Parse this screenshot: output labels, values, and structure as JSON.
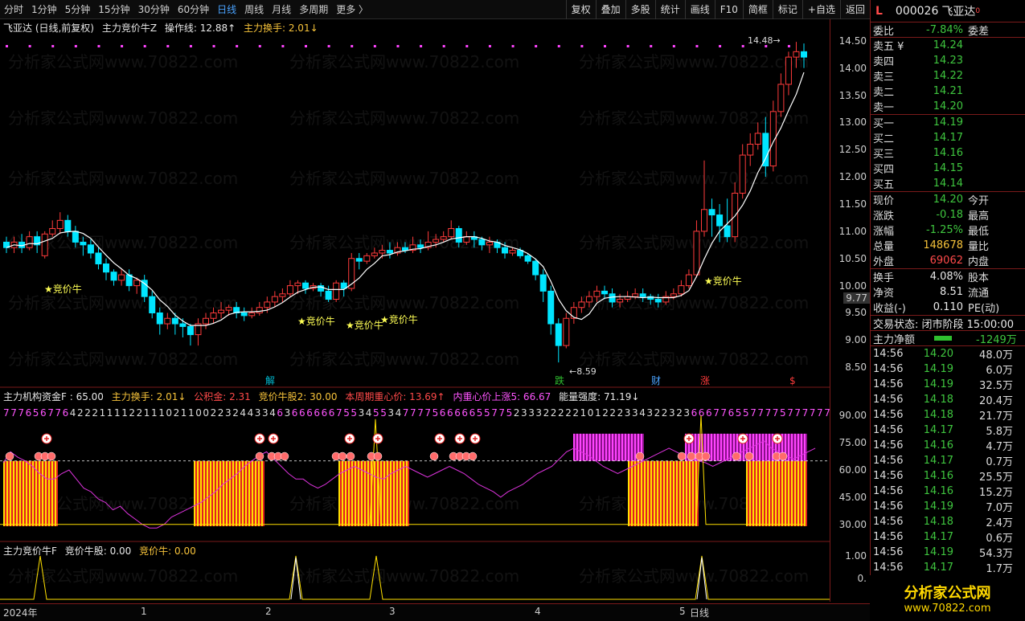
{
  "toolbar": {
    "periods": [
      "分时",
      "1分钟",
      "5分钟",
      "15分钟",
      "30分钟",
      "60分钟",
      "日线",
      "周线",
      "月线",
      "多周期",
      "更多 〉"
    ],
    "active_period": "日线",
    "tools": [
      "复权",
      "叠加",
      "多股",
      "统计",
      "画线",
      "F10",
      "简框",
      "标记",
      "+自选",
      "返回"
    ]
  },
  "main_panel": {
    "title": "飞亚达 (日线,前复权)",
    "indicator": "主力竞价牛Z",
    "op_line": "操作线: 12.88↑",
    "turnover": "主力换手: 2.01↓",
    "yticks": [
      "14.50",
      "14.00",
      "13.50",
      "13.00",
      "12.50",
      "12.00",
      "11.50",
      "11.00",
      "10.50",
      "10.00",
      "9.50",
      "9.00",
      "8.50"
    ],
    "price_marker": "9.77",
    "high_label": "14.48",
    "low_label": "8.59",
    "signal_label": "★竞价牛",
    "event_labels": [
      "解",
      "跌",
      "财",
      "涨",
      "$"
    ]
  },
  "mid_panel": {
    "title": "主力机构资金F : 65.00",
    "turnover": "主力换手: 2.01↓",
    "fund": "公积金: 2.31",
    "bull_stock2": "竞价牛股2: 30.00",
    "week_center": "本周期重心价: 13.69↑",
    "inner_center": "内重心价上涨5: 66.67",
    "energy": "能量强度: 71.19↓",
    "digits": "7776567764222111122111021100223244334636666667553455347777566666557752333222221012223343223236667765577775777777",
    "yticks": [
      "90.00",
      "75.00",
      "60.00",
      "45.00",
      "30.00"
    ]
  },
  "bottom_panel": {
    "title": "主力竞价牛F",
    "bull_stock": "竞价牛股: 0.00",
    "bull": "竞价牛: 0.00",
    "yticks": [
      "1.00",
      "0."
    ]
  },
  "xaxis": {
    "labels": [
      "2024年",
      "1",
      "2",
      "3",
      "4",
      "5"
    ],
    "right_label": "日线"
  },
  "quote": {
    "code": "000026",
    "name": "飞亚达",
    "badge_left": "L",
    "weibi_label": "委比",
    "weibi": "-7.84%",
    "weicha_label": "委差",
    "asks": [
      {
        "label": "卖五 ¥",
        "price": "14.24"
      },
      {
        "label": "卖四",
        "price": "14.23"
      },
      {
        "label": "卖三",
        "price": "14.22"
      },
      {
        "label": "卖二",
        "price": "14.21"
      },
      {
        "label": "卖一",
        "price": "14.20"
      }
    ],
    "bids": [
      {
        "label": "买一",
        "price": "14.19"
      },
      {
        "label": "买二",
        "price": "14.17"
      },
      {
        "label": "买三",
        "price": "14.16"
      },
      {
        "label": "买四",
        "price": "14.15"
      },
      {
        "label": "买五",
        "price": "14.14"
      }
    ],
    "stats": [
      {
        "a": "现价",
        "b": "14.20",
        "bc": "g",
        "c": "今开"
      },
      {
        "a": "涨跌",
        "b": "-0.18",
        "bc": "g",
        "c": "最高"
      },
      {
        "a": "涨幅",
        "b": "-1.25%",
        "bc": "g",
        "c": "最低"
      },
      {
        "a": "总量",
        "b": "148678",
        "bc": "y",
        "c": "量比"
      },
      {
        "a": "外盘",
        "b": "69062",
        "bc": "r",
        "c": "内盘"
      }
    ],
    "stats2": [
      {
        "a": "换手",
        "b": "4.08%",
        "c": "股本"
      },
      {
        "a": "净资",
        "b": "8.51",
        "c": "流通"
      },
      {
        "a": "收益(-)",
        "b": "0.110",
        "c": "PE(动)"
      }
    ],
    "trade_state": "交易状态: 闭市阶段 15:00:00",
    "net_label": "主力净额",
    "net_value": "-1249万",
    "ticks": [
      {
        "t": "14:56",
        "p": "14.20",
        "pc": "g",
        "v": "48.0万",
        "vc": "y"
      },
      {
        "t": "14:56",
        "p": "14.19",
        "pc": "g",
        "v": "6.0万",
        "vc": "y"
      },
      {
        "t": "14:56",
        "p": "14.19",
        "pc": "g",
        "v": "32.5万",
        "vc": "y"
      },
      {
        "t": "14:56",
        "p": "14.18",
        "pc": "g",
        "v": "20.4万",
        "vc": "y"
      },
      {
        "t": "14:56",
        "p": "14.18",
        "pc": "g",
        "v": "21.7万",
        "vc": "y"
      },
      {
        "t": "14:56",
        "p": "14.17",
        "pc": "g",
        "v": "5.8万",
        "vc": "y"
      },
      {
        "t": "14:56",
        "p": "14.16",
        "pc": "g",
        "v": "4.7万",
        "vc": "y"
      },
      {
        "t": "14:56",
        "p": "14.17",
        "pc": "g",
        "v": "0.7万",
        "vc": "y"
      },
      {
        "t": "14:56",
        "p": "14.16",
        "pc": "g",
        "v": "25.5万",
        "vc": "y"
      },
      {
        "t": "14:56",
        "p": "14.16",
        "pc": "g",
        "v": "15.2万",
        "vc": "y"
      },
      {
        "t": "14:56",
        "p": "14.19",
        "pc": "g",
        "v": "7.0万",
        "vc": "y"
      },
      {
        "t": "14:56",
        "p": "14.18",
        "pc": "g",
        "v": "2.4万",
        "vc": "y"
      },
      {
        "t": "14:56",
        "p": "14.17",
        "pc": "g",
        "v": "0.6万",
        "vc": "y"
      },
      {
        "t": "14:56",
        "p": "14.19",
        "pc": "g",
        "v": "54.3万",
        "vc": "y"
      },
      {
        "t": "14:56",
        "p": "14.17",
        "pc": "g",
        "v": "1.7万",
        "vc": "y"
      }
    ]
  },
  "watermark": "分析家公式网www.70822.com",
  "logo": {
    "t1": "分析家公式网",
    "t2": "www.70822.com"
  },
  "chart_data": {
    "type": "candlestick",
    "ylim": [
      8.4,
      14.6
    ],
    "candles": [
      [
        10.8,
        10.7,
        10.9,
        10.6
      ],
      [
        10.7,
        10.8,
        10.9,
        10.6
      ],
      [
        10.8,
        10.7,
        10.95,
        10.6
      ],
      [
        10.7,
        10.9,
        11.0,
        10.65
      ],
      [
        10.9,
        10.75,
        11.0,
        10.6
      ],
      [
        10.55,
        10.95,
        11.0,
        10.5
      ],
      [
        10.95,
        11.05,
        11.2,
        10.9
      ],
      [
        11.05,
        11.2,
        11.35,
        10.95
      ],
      [
        11.2,
        11.0,
        11.3,
        10.9
      ],
      [
        11.0,
        10.8,
        11.1,
        10.7
      ],
      [
        10.8,
        10.75,
        10.9,
        10.55
      ],
      [
        10.75,
        10.6,
        10.85,
        10.5
      ],
      [
        10.6,
        10.4,
        10.7,
        10.3
      ],
      [
        10.4,
        10.25,
        10.5,
        10.1
      ],
      [
        10.25,
        10.1,
        10.3,
        10.0
      ],
      [
        10.1,
        10.2,
        10.3,
        10.0
      ],
      [
        10.2,
        10.0,
        10.3,
        9.9
      ],
      [
        10.0,
        10.1,
        10.15,
        9.85
      ],
      [
        10.1,
        9.8,
        10.2,
        9.7
      ],
      [
        9.8,
        9.5,
        9.9,
        9.4
      ],
      [
        9.5,
        9.3,
        9.6,
        9.1
      ],
      [
        9.3,
        9.4,
        9.5,
        9.2
      ],
      [
        9.4,
        9.3,
        9.5,
        9.1
      ],
      [
        9.3,
        9.25,
        9.4,
        9.05
      ],
      [
        9.25,
        9.1,
        9.3,
        8.9
      ],
      [
        9.1,
        9.3,
        9.4,
        8.9
      ],
      [
        9.3,
        9.4,
        9.5,
        9.2
      ],
      [
        9.4,
        9.5,
        9.6,
        9.3
      ],
      [
        9.5,
        9.55,
        9.7,
        9.4
      ],
      [
        9.55,
        9.6,
        9.65,
        9.45
      ],
      [
        9.6,
        9.5,
        9.7,
        9.4
      ],
      [
        9.5,
        9.45,
        9.6,
        9.35
      ],
      [
        9.45,
        9.5,
        9.6,
        9.4
      ],
      [
        9.5,
        9.6,
        9.7,
        9.45
      ],
      [
        9.6,
        9.7,
        9.8,
        9.5
      ],
      [
        9.7,
        9.8,
        9.9,
        9.6
      ],
      [
        9.8,
        9.85,
        9.95,
        9.7
      ],
      [
        9.85,
        10.0,
        10.1,
        9.8
      ],
      [
        10.0,
        10.05,
        10.1,
        9.85
      ],
      [
        10.05,
        9.95,
        10.1,
        9.85
      ],
      [
        9.95,
        10.0,
        10.05,
        9.9
      ],
      [
        10.0,
        9.9,
        10.05,
        9.8
      ],
      [
        9.9,
        9.75,
        10.0,
        9.7
      ],
      [
        9.75,
        10.05,
        10.1,
        9.7
      ],
      [
        10.05,
        9.95,
        10.1,
        9.8
      ],
      [
        9.95,
        10.5,
        10.6,
        9.9
      ],
      [
        10.5,
        10.45,
        10.6,
        10.3
      ],
      [
        10.45,
        10.55,
        10.6,
        10.4
      ],
      [
        10.55,
        10.6,
        10.7,
        10.5
      ],
      [
        10.6,
        10.65,
        10.75,
        10.5
      ],
      [
        10.65,
        10.6,
        10.8,
        10.5
      ],
      [
        10.6,
        10.7,
        10.8,
        10.55
      ],
      [
        10.7,
        10.65,
        10.8,
        10.6
      ],
      [
        10.65,
        10.75,
        10.9,
        10.6
      ],
      [
        10.75,
        10.7,
        10.85,
        10.6
      ],
      [
        10.7,
        10.8,
        11.0,
        10.65
      ],
      [
        10.8,
        10.85,
        10.95,
        10.7
      ],
      [
        10.85,
        10.9,
        11.0,
        10.8
      ],
      [
        10.9,
        11.05,
        11.2,
        10.85
      ],
      [
        11.05,
        10.8,
        11.1,
        10.7
      ],
      [
        10.8,
        10.9,
        11.0,
        10.75
      ],
      [
        10.9,
        10.85,
        11.0,
        10.7
      ],
      [
        10.85,
        10.75,
        10.9,
        10.65
      ],
      [
        10.75,
        10.8,
        10.9,
        10.6
      ],
      [
        10.8,
        10.7,
        10.85,
        10.6
      ],
      [
        10.7,
        10.6,
        10.8,
        10.5
      ],
      [
        10.6,
        10.65,
        10.7,
        10.55
      ],
      [
        10.65,
        10.55,
        10.7,
        10.5
      ],
      [
        10.55,
        10.45,
        10.6,
        10.4
      ],
      [
        10.45,
        10.2,
        10.5,
        10.1
      ],
      [
        10.2,
        9.9,
        10.3,
        9.7
      ],
      [
        9.9,
        9.3,
        10.0,
        9.1
      ],
      [
        9.3,
        8.9,
        9.4,
        8.59
      ],
      [
        8.9,
        9.4,
        9.5,
        8.85
      ],
      [
        9.4,
        9.6,
        9.7,
        9.3
      ],
      [
        9.6,
        9.7,
        9.8,
        9.5
      ],
      [
        9.7,
        9.8,
        9.9,
        9.6
      ],
      [
        9.8,
        9.9,
        10.0,
        9.7
      ],
      [
        9.9,
        9.85,
        10.0,
        9.75
      ],
      [
        9.85,
        9.7,
        9.95,
        9.6
      ],
      [
        9.7,
        9.75,
        9.85,
        9.6
      ],
      [
        9.75,
        9.8,
        9.9,
        9.7
      ],
      [
        9.8,
        9.85,
        9.95,
        9.75
      ],
      [
        9.85,
        9.8,
        9.95,
        9.7
      ],
      [
        9.8,
        9.75,
        9.85,
        9.65
      ],
      [
        9.75,
        9.7,
        9.85,
        9.6
      ],
      [
        9.7,
        9.8,
        9.9,
        9.65
      ],
      [
        9.8,
        9.85,
        9.95,
        9.75
      ],
      [
        9.85,
        10.0,
        10.1,
        9.8
      ],
      [
        10.0,
        10.2,
        10.3,
        9.95
      ],
      [
        10.2,
        11.0,
        11.2,
        10.15
      ],
      [
        11.0,
        11.4,
        12.3,
        10.9
      ],
      [
        11.4,
        11.3,
        11.6,
        10.9
      ],
      [
        11.3,
        11.1,
        11.5,
        10.8
      ],
      [
        11.1,
        10.9,
        11.6,
        10.8
      ],
      [
        10.9,
        11.7,
        11.9,
        10.8
      ],
      [
        11.7,
        12.4,
        12.6,
        11.6
      ],
      [
        12.4,
        12.6,
        12.8,
        12.2
      ],
      [
        12.6,
        12.8,
        13.0,
        12.5
      ],
      [
        12.8,
        12.2,
        13.1,
        12.0
      ],
      [
        12.2,
        13.2,
        13.4,
        12.1
      ],
      [
        13.2,
        13.7,
        13.9,
        13.1
      ],
      [
        13.7,
        14.2,
        14.3,
        13.5
      ],
      [
        14.2,
        14.3,
        14.48,
        14.0
      ],
      [
        14.3,
        14.2,
        14.45,
        14.0
      ]
    ]
  }
}
